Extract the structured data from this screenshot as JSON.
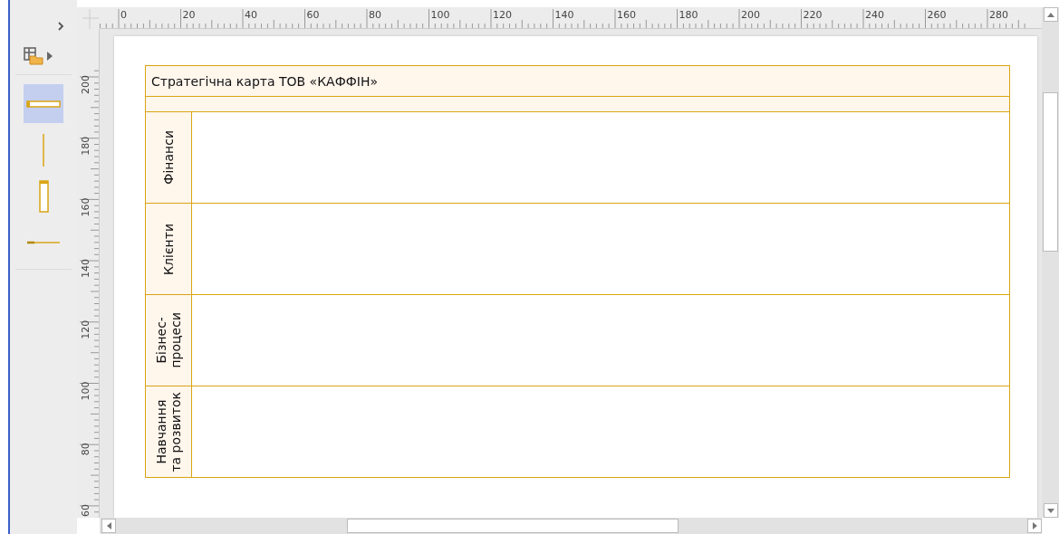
{
  "toolbox": {
    "items": [
      {
        "kind": "pool",
        "selected": true
      },
      {
        "kind": "vline",
        "selected": false
      },
      {
        "kind": "lane",
        "selected": false
      },
      {
        "kind": "hline",
        "selected": false
      }
    ]
  },
  "rulers": {
    "horizontal_labels": [
      "0",
      "20",
      "40",
      "60",
      "80",
      "100",
      "120",
      "140",
      "160",
      "180",
      "200",
      "220",
      "240",
      "260",
      "280"
    ],
    "vertical_labels": [
      "200",
      "180",
      "160",
      "140",
      "120",
      "100",
      "80",
      "60"
    ]
  },
  "diagram": {
    "title": "Стратегічна карта ТОВ «КАФФІН»",
    "lanes": [
      {
        "label": "Фінанси"
      },
      {
        "label": "Клієнти"
      },
      {
        "label": "Бізнес-\nпроцеси"
      },
      {
        "label": "Навчання\nта розвиток"
      }
    ]
  }
}
